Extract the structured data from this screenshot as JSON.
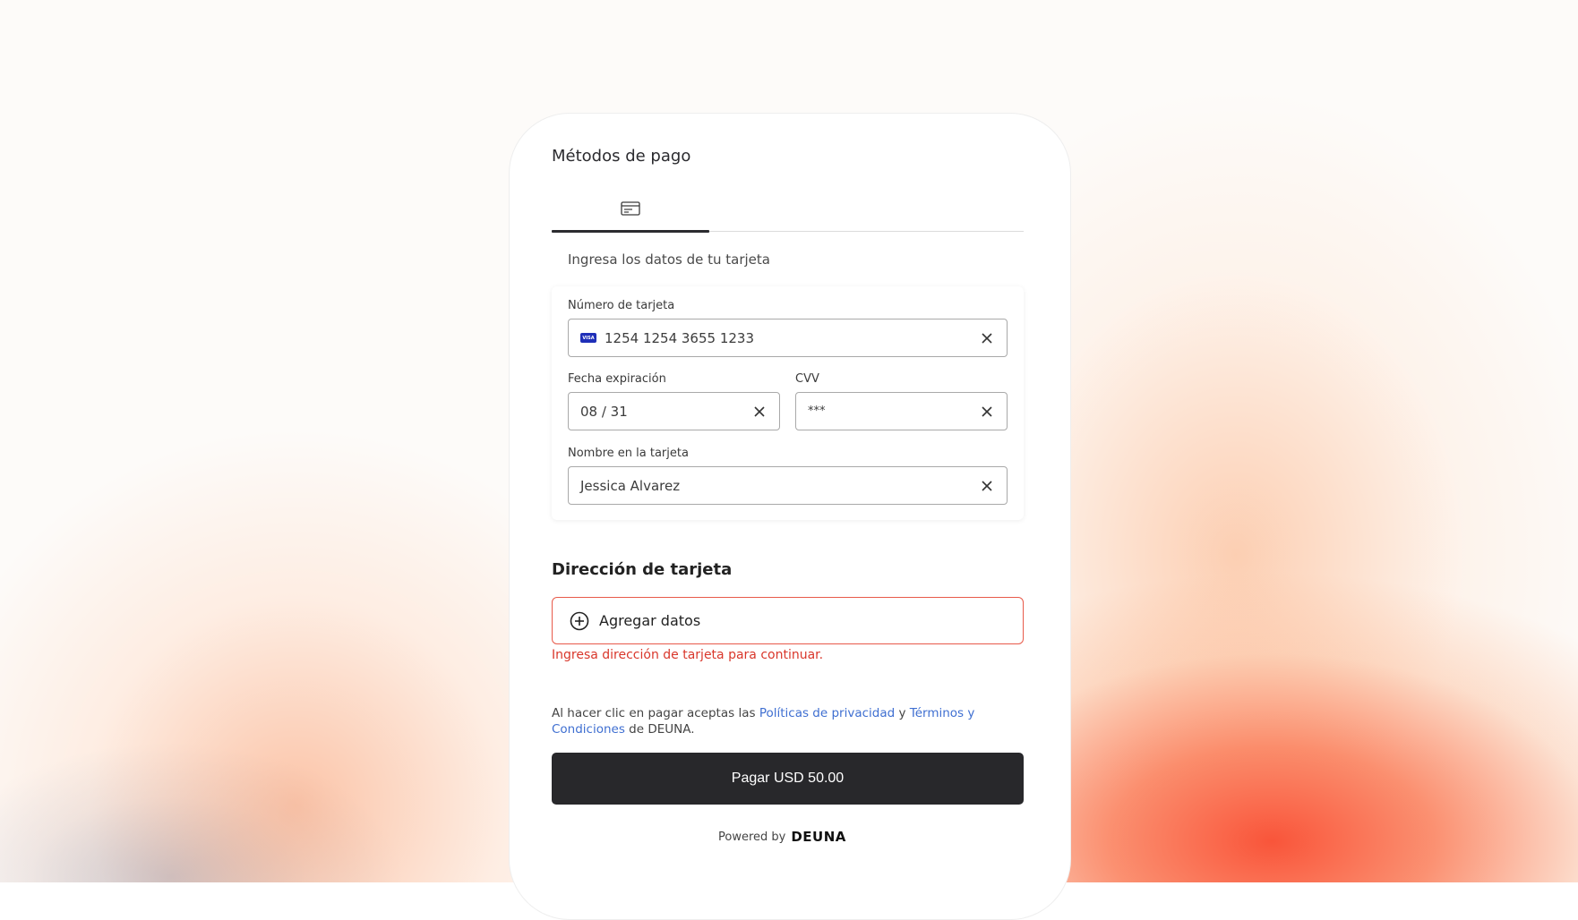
{
  "page": {
    "title": "Métodos de pago"
  },
  "tabs": [
    {
      "icon": "card-icon",
      "active": true
    }
  ],
  "card_form": {
    "subtitle": "Ingresa los datos de tu tarjeta",
    "card_number_label": "Número de tarjeta",
    "card_number_value": "1254 1254 3655 1233",
    "card_brand_text": "VISA",
    "expiry_label": "Fecha expiración",
    "expiry_value": "08 / 31",
    "cvv_label": "CVV",
    "cvv_value": "***",
    "name_label": "Nombre en la tarjeta",
    "name_value": "Jessica Alvarez"
  },
  "address": {
    "title": "Dirección de tarjeta",
    "add_label": "Agregar datos",
    "error": "Ingresa dirección de tarjeta para continuar."
  },
  "legal": {
    "prefix": "Al hacer clic en pagar aceptas las ",
    "privacy_link": "Políticas de privacidad",
    "connector": " y ",
    "terms_link": "Términos y Condiciones",
    "suffix": " de DEUNA."
  },
  "pay_button": "Pagar USD 50.00",
  "footer": {
    "powered_by": "Powered by",
    "brand": "DEUNA"
  },
  "colors": {
    "error": "#d9372b",
    "link": "#3f6fd1",
    "button": "#28282b",
    "card_brand": "#1f2fb8"
  }
}
